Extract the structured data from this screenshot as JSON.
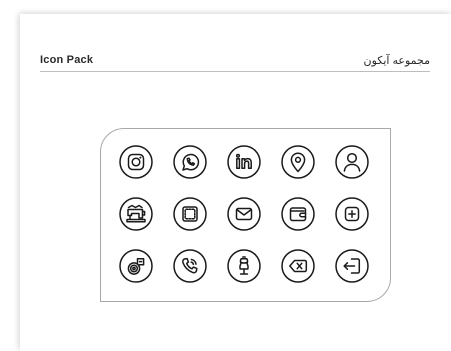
{
  "header": {
    "title_en": "Icon Pack",
    "title_fa": "مجموعه آیکون"
  },
  "icons": [
    "instagram-icon",
    "whatsapp-icon",
    "linkedin-icon",
    "location-pin-icon",
    "user-icon",
    "sewing-machine-icon",
    "stitched-patch-icon",
    "mail-icon",
    "wallet-icon",
    "add-square-icon",
    "thread-spool-icon",
    "phone-call-icon",
    "dress-form-icon",
    "backspace-icon",
    "logout-icon"
  ],
  "colors": {
    "stroke": "#1a1a1a",
    "rule": "#bdbdbd",
    "card_border": "#a8a8a8"
  }
}
